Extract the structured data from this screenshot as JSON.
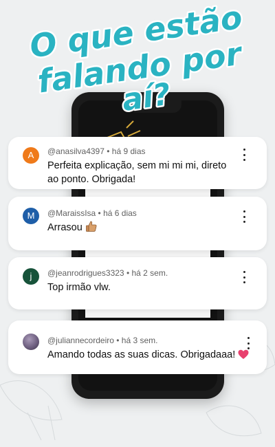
{
  "headline": {
    "line1": "O que estão",
    "line2": "falando por",
    "line3": "aí?"
  },
  "colors": {
    "headline_fill": "#2ab3c2",
    "headline_outline": "#ffffff",
    "card_bg": "#ffffff"
  },
  "comments": [
    {
      "avatar_letter": "A",
      "avatar_color": "#ef7a1a",
      "username": "@anasilva4397",
      "time": "há 9 dias",
      "text": "Perfeita explicação, sem mi mi mi, direto ao ponto. Obrigada!",
      "menu_icon": "more-vert-icon"
    },
    {
      "avatar_letter": "M",
      "avatar_color": "#1e5ea8",
      "username": "@MaraissIsa",
      "time": "há 6 dias",
      "text": "Arrasou",
      "emoji": "thumbs-up-icon",
      "menu_icon": "more-vert-icon"
    },
    {
      "avatar_letter": "j",
      "avatar_color": "#17533a",
      "username": "@jeanrodrigues3323",
      "time": "há 2 sem.",
      "text": "Top irmão vlw.",
      "menu_icon": "more-vert-icon"
    },
    {
      "avatar_letter": "",
      "avatar_color": "#7a6d8a",
      "username": "@juliannecordeiro",
      "time": "há 3 sem.",
      "text": "Amando todas as suas dicas. Obrigadaaa!",
      "emoji": "heart-icon",
      "menu_icon": "more-vert-icon"
    }
  ],
  "separator": "•"
}
